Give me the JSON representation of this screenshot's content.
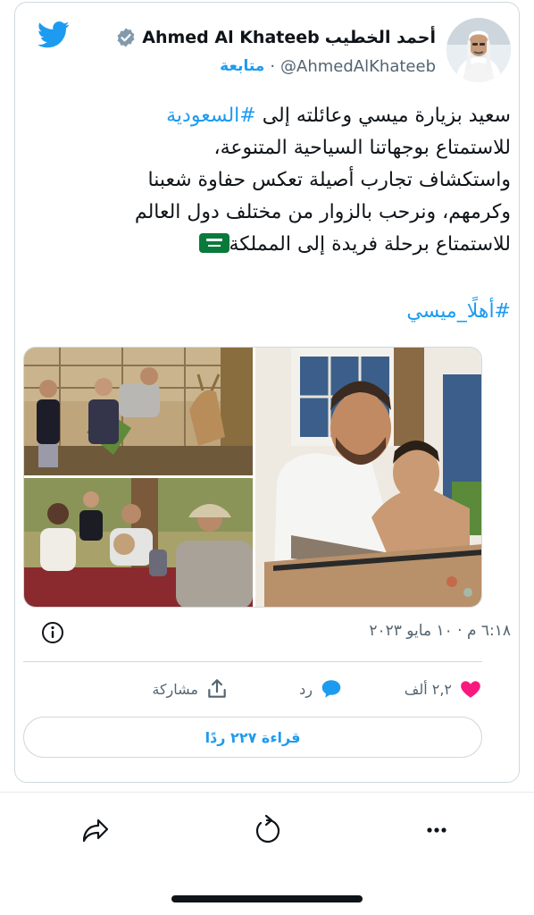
{
  "author": {
    "name_ar": "أحمد الخطيب",
    "name_en": "Ahmed Al Khateeb",
    "handle": "@AhmedAlKhateeb",
    "separator": "·",
    "follow_label": "متابعة",
    "verified": true
  },
  "tweet": {
    "line1_text": "سعيد بزيارة ميسي وعائلته إلى ",
    "line1_hashtag": "#السعودية",
    "line2": "للاستمتاع بوجهاتنا السياحية المتنوعة،",
    "line3": "واستكشاف تجارب أصيلة تعكس حفاوة شعبنا",
    "line4": "وكرمهم، ونرحب بالزوار من مختلف دول العالم",
    "line5": "للاستمتاع برحلة فريدة إلى المملكة",
    "hashtag2": "#أهلًا_ميسي"
  },
  "meta": {
    "timestamp": "٦:١٨ م · ١٠ مايو ٢٠٢٣"
  },
  "actions": {
    "likes": "٢,٢ ألف",
    "reply_label": "رد",
    "share_label": "مشاركة"
  },
  "read_replies_label": "قراءة ٢٢٧ ردًا",
  "colors": {
    "accent": "#1d9bf0",
    "like": "#f91880",
    "text": "#0f1419",
    "muted": "#536471",
    "border": "#cfd9de"
  }
}
